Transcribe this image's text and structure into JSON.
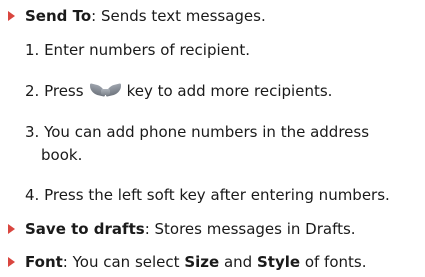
{
  "items": [
    {
      "label": "Send To",
      "desc": ": Sends text messages."
    },
    {
      "label": "Save to drafts",
      "desc": ": Stores messages in Drafts."
    }
  ],
  "steps": [
    "1. Enter numbers of recipient.",
    {
      "before": "2. Press",
      "after": "key to add more recipients.",
      "icon": "send-key-icon"
    },
    {
      "line1": "3. You can add phone numbers in the address",
      "line2": "book."
    },
    "4. Press the left soft key after entering numbers."
  ],
  "font": {
    "label": "Font",
    "desc_a": ": You can select",
    "size": "Size",
    "and": "and",
    "style": "Style",
    "desc_b": "of fonts."
  },
  "colors": {
    "bullet": "#d9463f",
    "text": "#1a1a1a"
  }
}
